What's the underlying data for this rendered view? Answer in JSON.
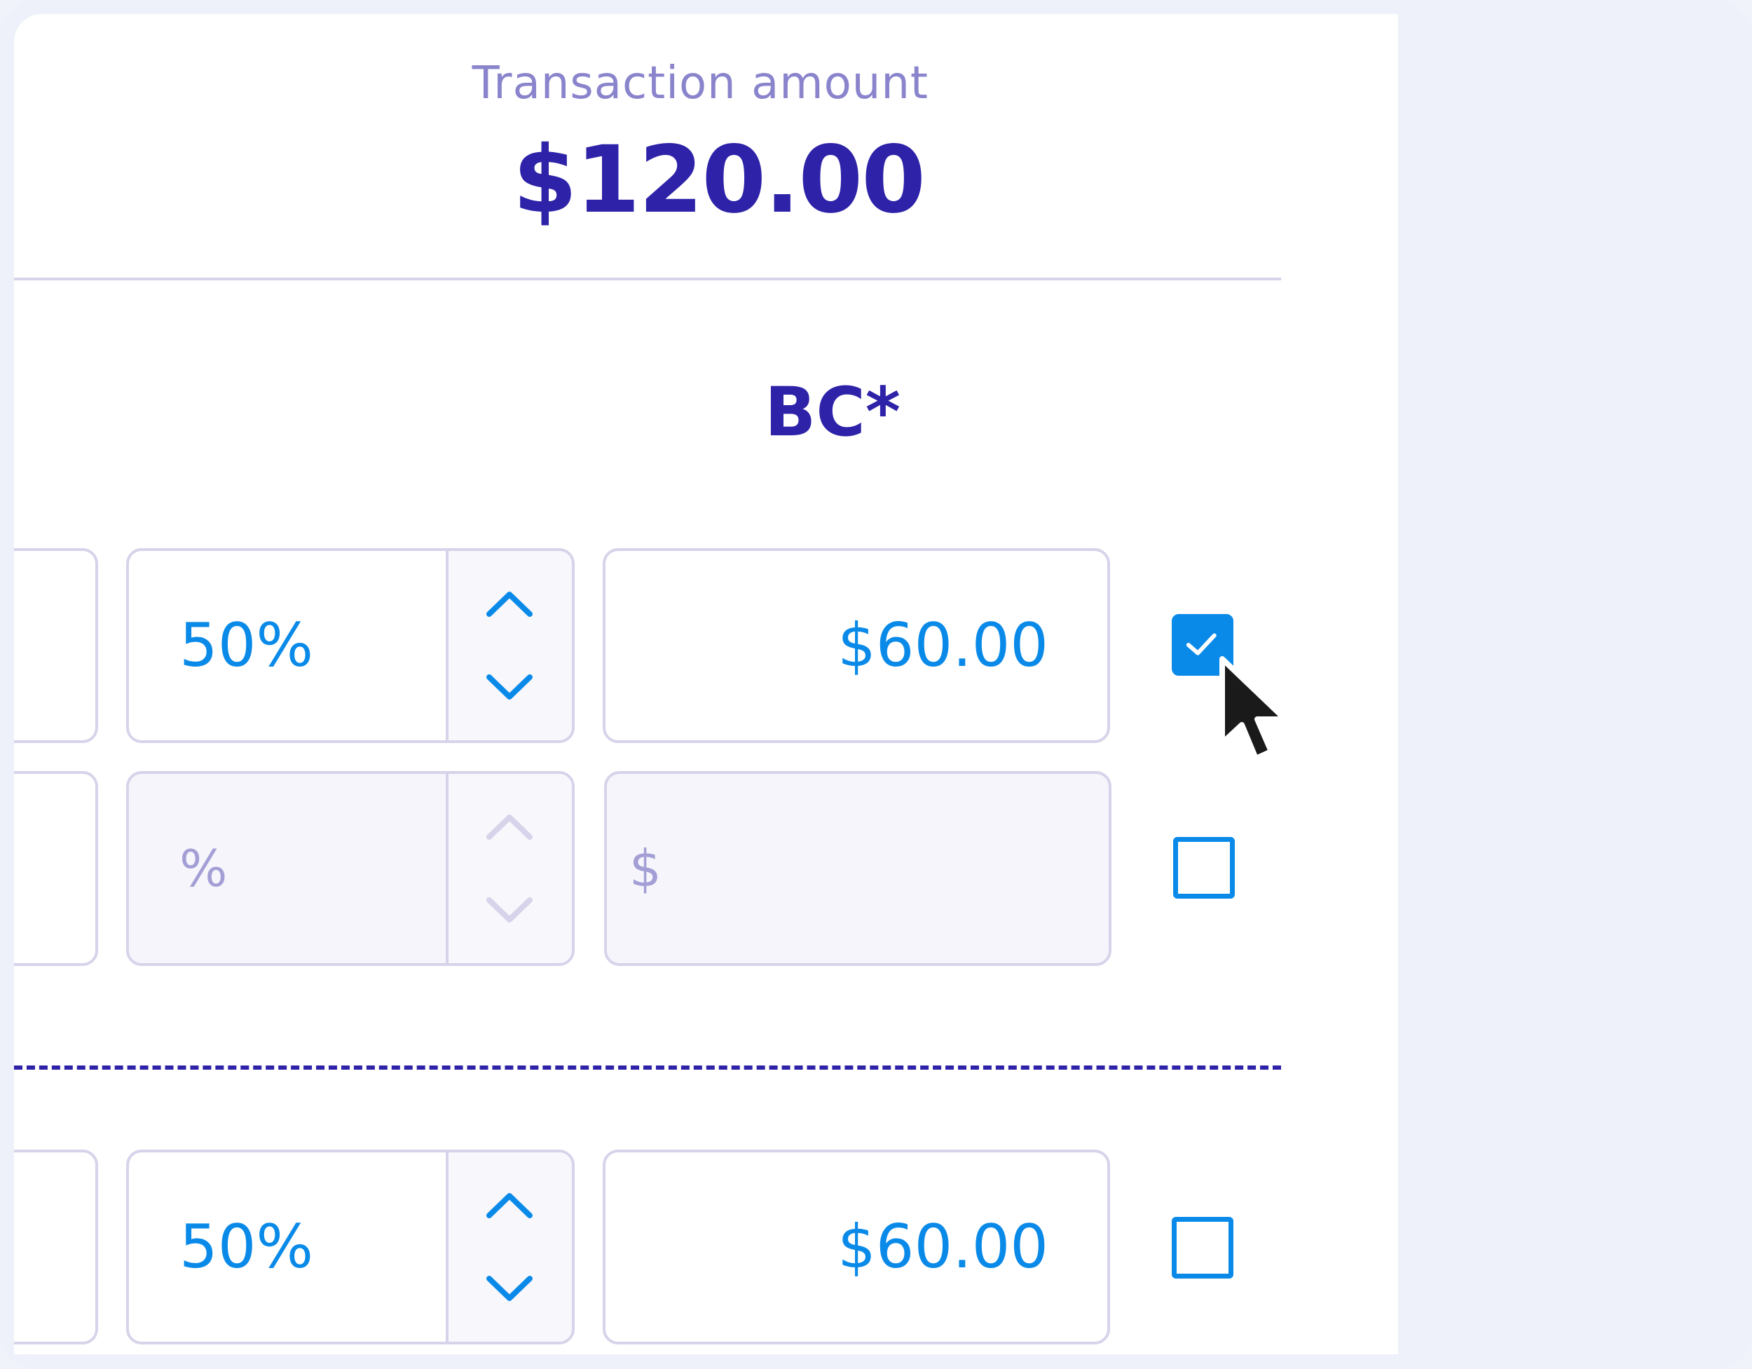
{
  "transaction": {
    "label": "Transaction amount",
    "amount": "$120.00"
  },
  "column_header": "BC*",
  "rows": [
    {
      "percent": "50%",
      "dollar": "$60.00",
      "checked": true
    },
    {
      "percent_placeholder": "%",
      "dollar_placeholder": "$",
      "checked": false
    },
    {
      "percent": "50%",
      "dollar": "$60.00",
      "checked": false
    }
  ],
  "icons": {
    "increment": "chevron-up-icon",
    "decrement": "chevron-down-icon",
    "check": "checkmark-icon",
    "pointer": "mouse-cursor-icon"
  },
  "colors": {
    "primary": "#2e22a8",
    "accent": "#0a8ae8",
    "muted": "#8a84cc",
    "border": "#d6d3ea"
  }
}
